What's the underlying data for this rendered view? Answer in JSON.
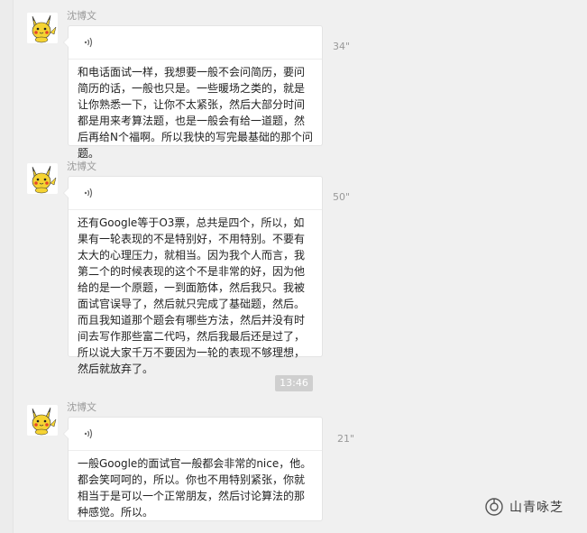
{
  "messages": [
    {
      "sender": "沈博文",
      "duration": "34\"",
      "transcript": "和电话面试一样，我想要一般不会问简历，要问简历的话，一般也只是。一些暖场之类的，就是让你熟悉一下，让你不太紧张，然后大部分时间都是用来考算法题，也是一般会有给一道题，然后再给N个福啊。所以我快的写完最基础的那个问题。"
    },
    {
      "sender": "沈博文",
      "duration": "50\"",
      "transcript": "还有Google等于O3票，总共是四个，所以，如果有一轮表现的不是特别好，不用特别。不要有太大的心理压力，就相当。因为我个人而言，我第二个的时候表现的这个不是非常的好，因为他给的是一个原题，一到面筋体，然后我只。我被面试官误导了，然后就只完成了基础题，然后。而且我知道那个题会有哪些方法，然后并没有时间去写作那些富二代吗，然后我最后还是过了，所以说大家千万不要因为一轮的表现不够理想，然后就放弃了。"
    },
    {
      "sender": "沈博文",
      "duration": "21\"",
      "transcript": "一般Google的面试官一般都会非常的nice，他。都会笑呵呵的，所以。你也不用特别紧张，你就相当于是可以一个正常朋友，然后讨论算法的那种感觉。所以。"
    }
  ],
  "time_divider": "13:46",
  "watermark": {
    "text": "山青咏芝",
    "icon": "wechat-official-account-icon"
  },
  "icons": {
    "avatar": "pikachu-avatar-icon",
    "voice": "voice-wave-icon"
  }
}
